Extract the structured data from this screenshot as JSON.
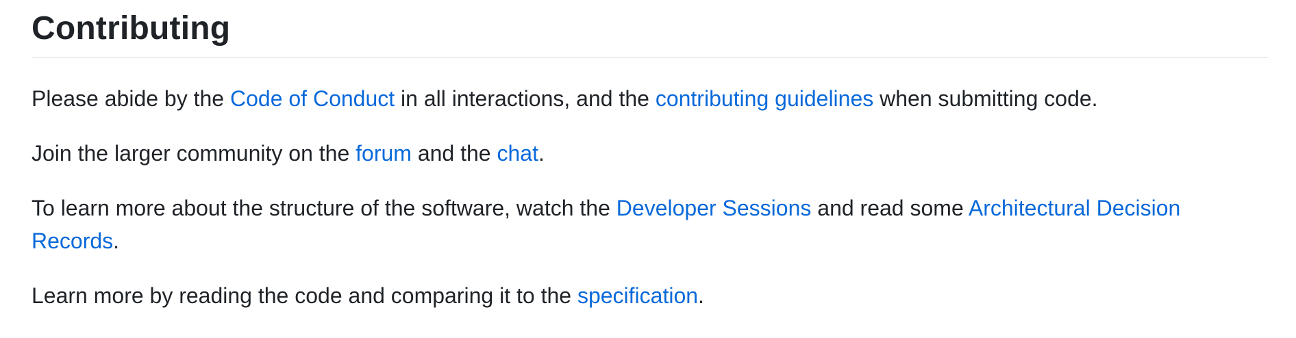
{
  "heading": "Contributing",
  "paragraphs": {
    "p1": {
      "t1": "Please abide by the ",
      "link1": "Code of Conduct",
      "t2": " in all interactions, and the ",
      "link2": "contributing guidelines",
      "t3": " when submitting code."
    },
    "p2": {
      "t1": "Join the larger community on the ",
      "link1": "forum",
      "t2": " and the ",
      "link2": "chat",
      "t3": "."
    },
    "p3": {
      "t1": "To learn more about the structure of the software, watch the ",
      "link1": "Developer Sessions",
      "t2": " and read some ",
      "link2": "Architectural Decision Records",
      "t3": "."
    },
    "p4": {
      "t1": "Learn more by reading the code and comparing it to the ",
      "link1": "specification",
      "t2": "."
    }
  },
  "colors": {
    "text": "#1f2328",
    "link": "#0969da",
    "divider": "#d8dee4"
  }
}
